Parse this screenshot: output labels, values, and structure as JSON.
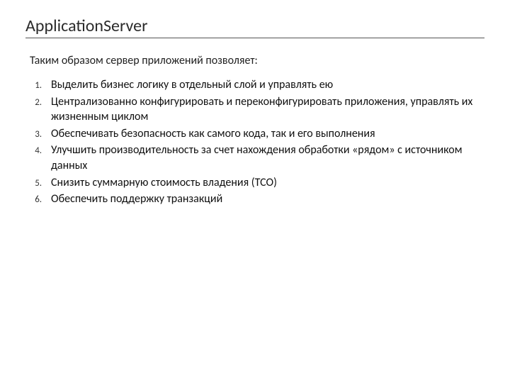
{
  "title": "ApplicationServer",
  "intro": "Таким образом сервер приложений позволяет:",
  "points": [
    "Выделить бизнес логику в отдельный слой и управлять ею",
    "Централизованно конфигурировать и переконфигурировать приложения, управлять их жизненным циклом",
    "Обеспечивать безопасность как самого кода, так и его выполнения",
    "Улучшить производительность за счет нахождения обработки «рядом» с источником данных",
    "Снизить суммарную стоимость владения (TCO)",
    "Обеспечить поддержку транзакций"
  ]
}
